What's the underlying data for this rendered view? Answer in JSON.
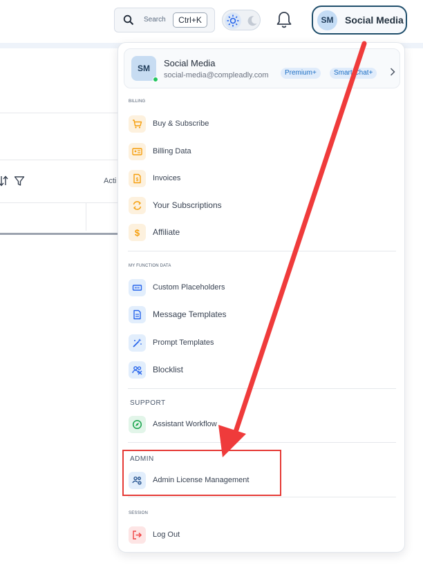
{
  "header": {
    "search_label": "Search",
    "search_shortcut": "Ctrl+K",
    "user_initials": "SM",
    "user_name": "Social Media"
  },
  "background": {
    "column_label": "Acti"
  },
  "menu": {
    "profile": {
      "initials": "SM",
      "name": "Social Media",
      "email": "social-media@compleadly.com",
      "badges": [
        "Premium+",
        "Smart Chat+"
      ]
    },
    "sections": {
      "billing": "BILLING",
      "function": "MY FUNCTION DATA",
      "support": "SUPPORT",
      "admin": "ADMIN",
      "session": "SESSION"
    },
    "billing_items": [
      "Buy & Subscribe",
      "Billing Data",
      "Invoices",
      "Your Subscriptions",
      "Affiliate"
    ],
    "function_items": [
      "Custom Placeholders",
      "Message Templates",
      "Prompt Templates",
      "Blocklist"
    ],
    "support_items": [
      "Assistant Workflow"
    ],
    "admin_items": [
      "Admin License Management"
    ],
    "session_items": [
      "Log Out"
    ]
  },
  "colors": {
    "accent": "#1d6fc4",
    "annotation": "#e53935",
    "online": "#22c55e"
  }
}
